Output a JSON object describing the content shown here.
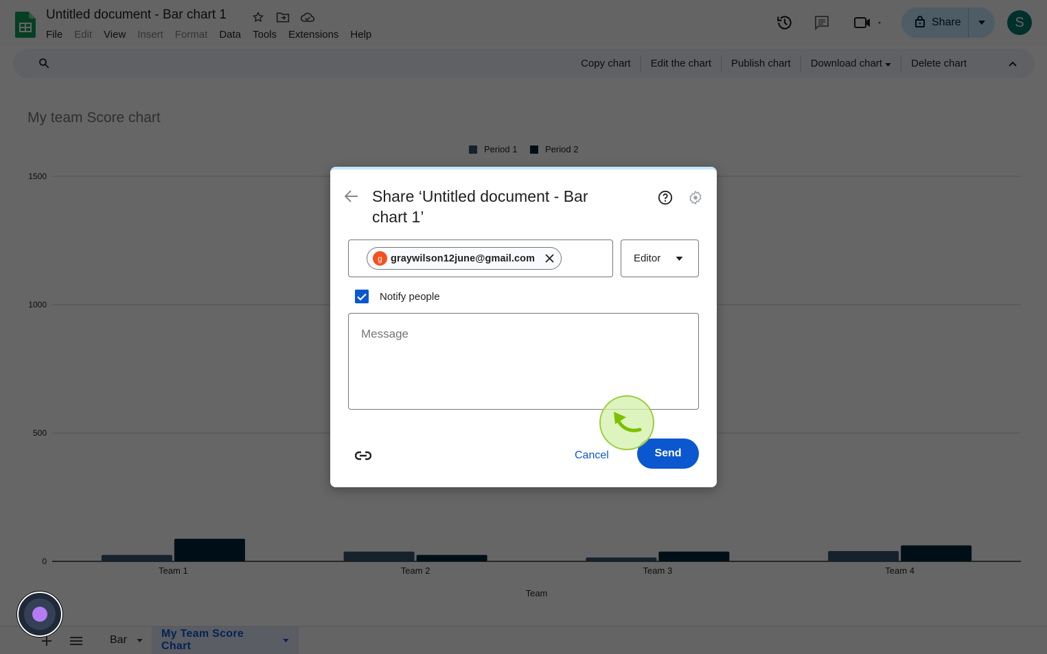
{
  "app": {
    "document_title": "Untitled document - Bar chart 1",
    "menu": [
      {
        "label": "File",
        "enabled": true
      },
      {
        "label": "Edit",
        "enabled": false
      },
      {
        "label": "View",
        "enabled": true
      },
      {
        "label": "Insert",
        "enabled": false
      },
      {
        "label": "Format",
        "enabled": false
      },
      {
        "label": "Data",
        "enabled": true
      },
      {
        "label": "Tools",
        "enabled": true
      },
      {
        "label": "Extensions",
        "enabled": true
      },
      {
        "label": "Help",
        "enabled": true
      }
    ],
    "share_label": "Share",
    "avatar_letter": "S"
  },
  "chart_toolbar": {
    "actions": [
      "Copy chart",
      "Edit the chart",
      "Publish chart",
      "Download chart",
      "Delete chart"
    ]
  },
  "chart_data": {
    "type": "bar",
    "title": "My team Score chart",
    "xlabel": "Team",
    "ylabel": "",
    "categories": [
      "Team 1",
      "Team 2",
      "Team 3",
      "Team 4"
    ],
    "series": [
      {
        "name": "Period 1",
        "color": "#36566b",
        "values": [
          25,
          38,
          15,
          40
        ]
      },
      {
        "name": "Period 2",
        "color": "#00263a",
        "values": [
          88,
          25,
          38,
          62
        ]
      }
    ],
    "ylim": [
      0,
      1500
    ],
    "yticks": [
      0,
      500,
      1000,
      1500
    ],
    "grid": true,
    "legend": "top-center"
  },
  "sheets": {
    "tabs": [
      {
        "label": "Bar",
        "active": false
      },
      {
        "label": "My Team Score Chart",
        "active": true
      }
    ]
  },
  "dialog": {
    "title": "Share ‘Untitled document - Bar chart 1’",
    "recipient": {
      "initial": "g",
      "email": "graywilson12june@gmail.com"
    },
    "role": "Editor",
    "notify_label": "Notify people",
    "notify_checked": true,
    "message_placeholder": "Message",
    "cancel_label": "Cancel",
    "send_label": "Send"
  },
  "colors": {
    "accent": "#0b57d0",
    "share_button": "#c2e7ff",
    "chip_avatar": "#f4511e",
    "avatar": "#00796b"
  }
}
